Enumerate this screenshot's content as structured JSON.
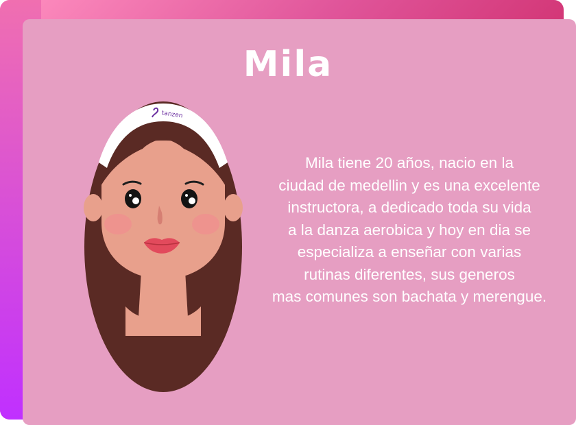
{
  "profile": {
    "name": "Mila",
    "headband_brand": "tanzen",
    "bio_lines": [
      "Mila tiene 20 años, nacio en la",
      "ciudad de medellin y es una excelente",
      "instructora, a dedicado toda su vida",
      "a la danza aerobica y hoy en dia se",
      "especializa a enseñar con varias",
      "rutinas diferentes, sus generos",
      "mas comunes son bachata y merengue."
    ]
  },
  "colors": {
    "card_background": "#e69ec2",
    "accent_gradient_start": "#ff8fc0",
    "accent_gradient_end": "#ff1a72",
    "hair": "#5a2a24",
    "skin": "#e8a08c",
    "text": "#ffffff"
  }
}
